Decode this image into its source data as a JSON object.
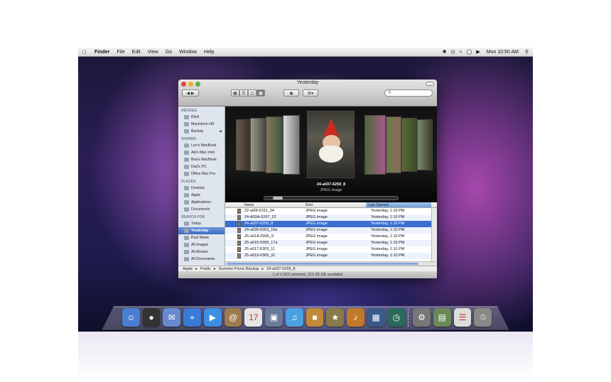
{
  "menubar": {
    "app": "Finder",
    "items": [
      "File",
      "Edit",
      "View",
      "Go",
      "Window",
      "Help"
    ],
    "clock": "Mon 10:50 AM"
  },
  "window": {
    "title": "Yesterday",
    "search_placeholder": ""
  },
  "sidebar": {
    "sections": [
      {
        "title": "DEVICES",
        "items": [
          {
            "label": "iDisk",
            "icon": "idisk-icon"
          },
          {
            "label": "Macintosh HD",
            "icon": "harddisk-icon"
          },
          {
            "label": "Backup",
            "icon": "harddisk-icon"
          }
        ]
      },
      {
        "title": "SHARED",
        "items": [
          {
            "label": "Leo's MacBook",
            "icon": "laptop-icon"
          },
          {
            "label": "Aki's Mac mini",
            "icon": "macmini-icon"
          },
          {
            "label": "Bea's MacBook",
            "icon": "laptop-icon"
          },
          {
            "label": "Dad's PC",
            "icon": "pc-icon"
          },
          {
            "label": "Office Mac Pro",
            "icon": "macpro-icon"
          }
        ]
      },
      {
        "title": "PLACES",
        "items": [
          {
            "label": "Desktop",
            "icon": "desktop-icon"
          },
          {
            "label": "Apple",
            "icon": "home-icon"
          },
          {
            "label": "Applications",
            "icon": "applications-icon"
          },
          {
            "label": "Documents",
            "icon": "documents-icon"
          }
        ]
      },
      {
        "title": "SEARCH FOR",
        "items": [
          {
            "label": "Today",
            "icon": "clock-icon"
          },
          {
            "label": "Yesterday",
            "icon": "clock-icon"
          },
          {
            "label": "Past Week",
            "icon": "clock-icon"
          },
          {
            "label": "All Images",
            "icon": "smartfolder-icon"
          },
          {
            "label": "All Movies",
            "icon": "smartfolder-icon"
          },
          {
            "label": "All Documents",
            "icon": "smartfolder-icon"
          }
        ]
      }
    ]
  },
  "coverflow": {
    "selected_name": "24-a037-6259_8",
    "selected_kind": "JPEG image"
  },
  "list": {
    "columns": [
      "Name",
      "Kind",
      "Last Opened"
    ],
    "rows": [
      {
        "name": "22-a00f-6151_34",
        "kind": "JPEG image",
        "opened": "Yesterday, 1:10 PM"
      },
      {
        "name": "24-A03A-6267_22",
        "kind": "JPEG image",
        "opened": "Yesterday, 1:10 PM"
      },
      {
        "name": "24-a037-6259_8",
        "kind": "JPEG image",
        "opened": "Yesterday, 1:10 PM"
      },
      {
        "name": "24-a039-6263_16a",
        "kind": "JPEG image",
        "opened": "Yesterday, 1:10 PM"
      },
      {
        "name": "25-a01A-6306_9",
        "kind": "JPEG image",
        "opened": "Yesterday, 1:10 PM"
      },
      {
        "name": "25-a015-6300_17a",
        "kind": "JPEG image",
        "opened": "Yesterday, 1:10 PM"
      },
      {
        "name": "25-a017-6303_11",
        "kind": "JPEG image",
        "opened": "Yesterday, 1:10 PM"
      },
      {
        "name": "25-a019-6305_31",
        "kind": "JPEG image",
        "opened": "Yesterday, 1:10 PM"
      }
    ],
    "selected_index": 2
  },
  "pathbar": [
    "Apple",
    "Public",
    "Summer Picnic Backup",
    "24-a037-6259_8"
  ],
  "status": "1 of 2,923 selected, 212.45 GB available",
  "colors": {
    "selection": "#3a6fd0",
    "sidebar_bg": "#dfe5ee"
  },
  "dock": {
    "icons": [
      "finder-icon",
      "dashboard-icon",
      "mail-icon",
      "safari-icon",
      "ichat-icon",
      "addressbook-icon",
      "ical-icon",
      "preview-icon",
      "itunes-icon",
      "iphoto-icon",
      "imovie-icon",
      "garageband-icon",
      "spaces-icon",
      "timemachine-icon",
      "systempreferences-icon",
      "photos-stack-icon",
      "documents-stack-icon",
      "trash-icon"
    ]
  }
}
